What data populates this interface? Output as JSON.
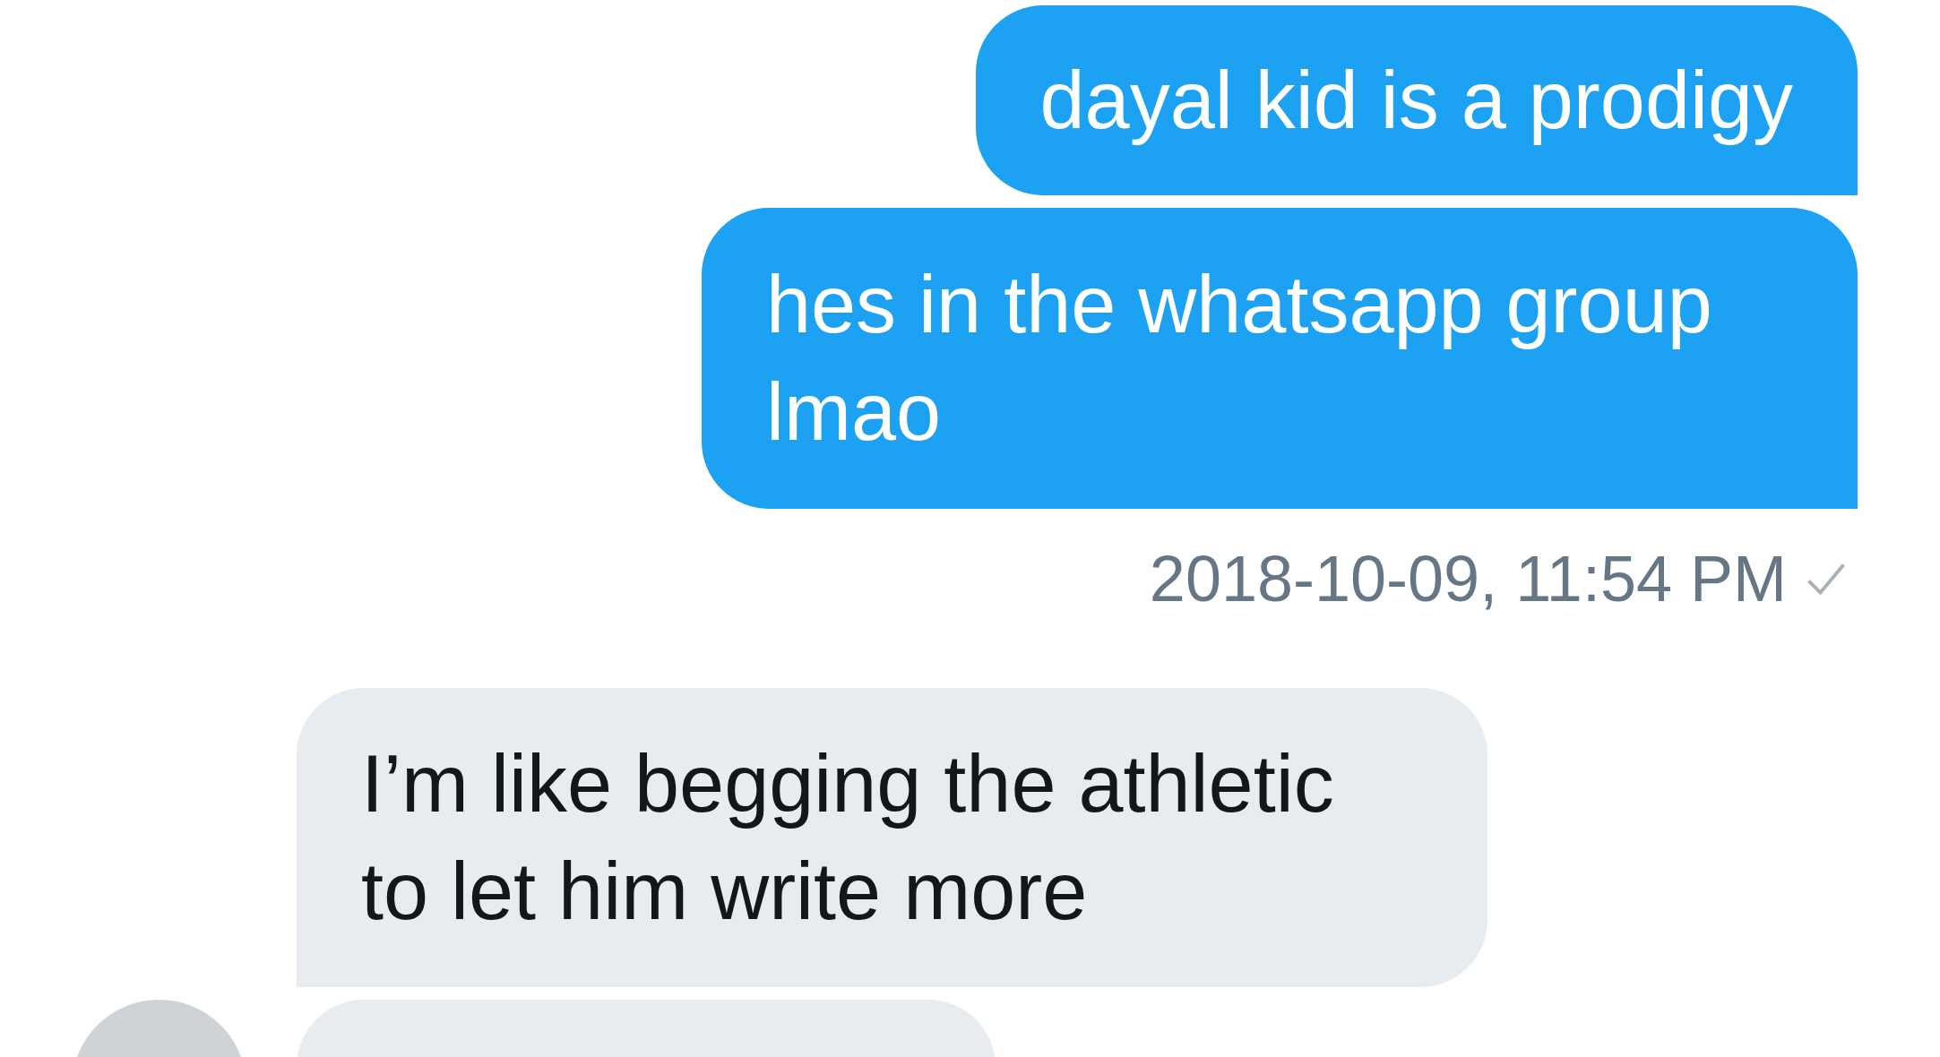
{
  "messages": [
    {
      "kind": "sent",
      "text": "dayal kid is a prodigy"
    },
    {
      "kind": "sent",
      "text": "hes in the whatsapp group lmao"
    }
  ],
  "receipt": {
    "timestamp": "2018-10-09, 11:54 PM",
    "delivered": true
  },
  "replies": [
    {
      "kind": "received",
      "text": "I’m like begging the athletic to let him write more",
      "avatar": false
    },
    {
      "kind": "received",
      "avatar": true
    }
  ]
}
